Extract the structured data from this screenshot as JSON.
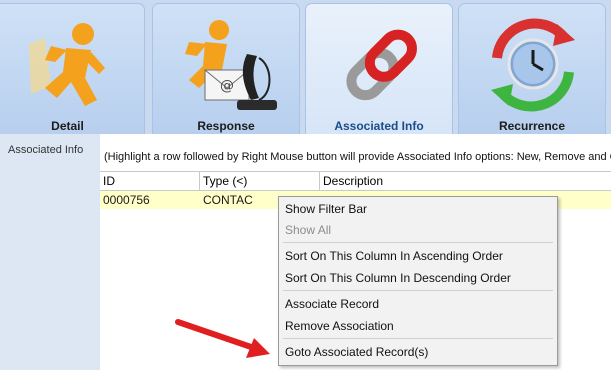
{
  "tabs": [
    {
      "label": "Detail",
      "icon": "running-man-icon"
    },
    {
      "label": "Response",
      "icon": "running-man-phone-mail-icon"
    },
    {
      "label": "Associated Info",
      "icon": "chain-link-icon"
    },
    {
      "label": "Recurrence",
      "icon": "clock-recurrence-icon"
    }
  ],
  "active_tab": "Associated Info",
  "section_label": "Associated Info",
  "hint": "(Highlight a row followed by Right Mouse button will provide Associated Info options: New, Remove and Goto)",
  "grid": {
    "columns": [
      "ID",
      "Type (<)",
      "Description"
    ],
    "rows": [
      {
        "id": "0000756",
        "type": "CONTAC",
        "description": ""
      }
    ]
  },
  "context_menu": {
    "items": [
      {
        "label": "Show Filter Bar",
        "enabled": true
      },
      {
        "label": "Show All",
        "enabled": false
      },
      {
        "label": "Sort On This Column In Ascending Order",
        "enabled": true
      },
      {
        "label": "Sort On This Column In Descending Order",
        "enabled": true
      },
      {
        "label": "Associate Record",
        "enabled": true
      },
      {
        "label": "Remove Association",
        "enabled": true
      },
      {
        "label": "Goto Associated Record(s)",
        "enabled": true
      }
    ]
  },
  "colors": {
    "tab_bg": "#c9daf0",
    "selected_row": "#ffffc9",
    "active_tab_text": "#1b4d8a",
    "annotation_arrow": "#e02020"
  }
}
